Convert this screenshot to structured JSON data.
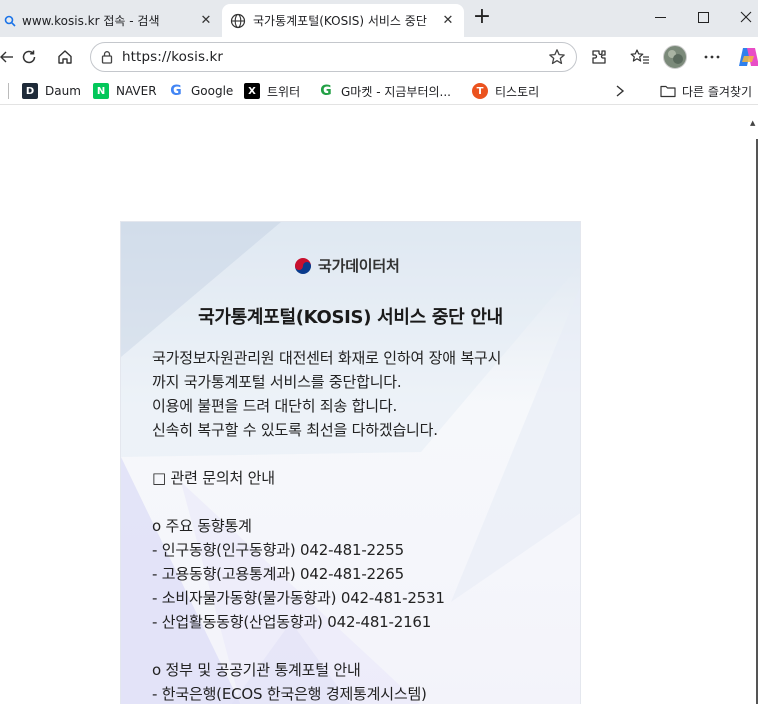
{
  "tabs": [
    {
      "title": "www.kosis.kr 접속 - 검색",
      "active": false
    },
    {
      "title": "국가통계포털(KOSIS) 서비스 중단 ",
      "active": true
    }
  ],
  "address_bar": {
    "url": "https://kosis.kr"
  },
  "bookmarks": [
    {
      "label": "Daum",
      "icon": "daum-icon",
      "icon_text": "D",
      "color": "#1e2a38"
    },
    {
      "label": "NAVER",
      "icon": "naver-icon",
      "icon_text": "N",
      "color": "#03c75a"
    },
    {
      "label": "Google",
      "icon": "google-icon",
      "icon_text": "G",
      "color": "#4285f4"
    },
    {
      "label": "트위터",
      "icon": "x-icon",
      "icon_text": "X",
      "color": "#000000"
    },
    {
      "label": "G마켓 - 지금부터의...",
      "icon": "gmarket-icon",
      "icon_text": "G",
      "color": "#22a045"
    },
    {
      "label": "티스토리",
      "icon": "tistory-icon",
      "icon_text": "T",
      "color": "#eb531f"
    }
  ],
  "other_favorites": "다른 즐겨찾기",
  "notice": {
    "logo_text": "국가데이터처",
    "title": "국가통계포털(KOSIS) 서비스 중단 안내",
    "lines": [
      "국가정보자원관리원 대전센터 화재로 인하여 장애 복구시",
      "까지 국가통계포털 서비스를 중단합니다.",
      "이용에 불편을 드려 대단히 죄송 합니다.",
      "신속히 복구할 수 있도록 최선을 다하겠습니다.",
      "",
      "□ 관련 문의처 안내",
      "",
      "o 주요 동향통계",
      "- 인구동향(인구동향과) 042-481-2255",
      "- 고용동향(고용통계과) 042-481-2265",
      "- 소비자물가동향(물가동향과) 042-481-2531",
      "- 산업활동동향(산업동향과) 042-481-2161",
      "",
      "o 정부 및 공공기관 통계포털 안내",
      "- 한국은행(ECOS 한국은행 경제통계시스템)"
    ]
  }
}
